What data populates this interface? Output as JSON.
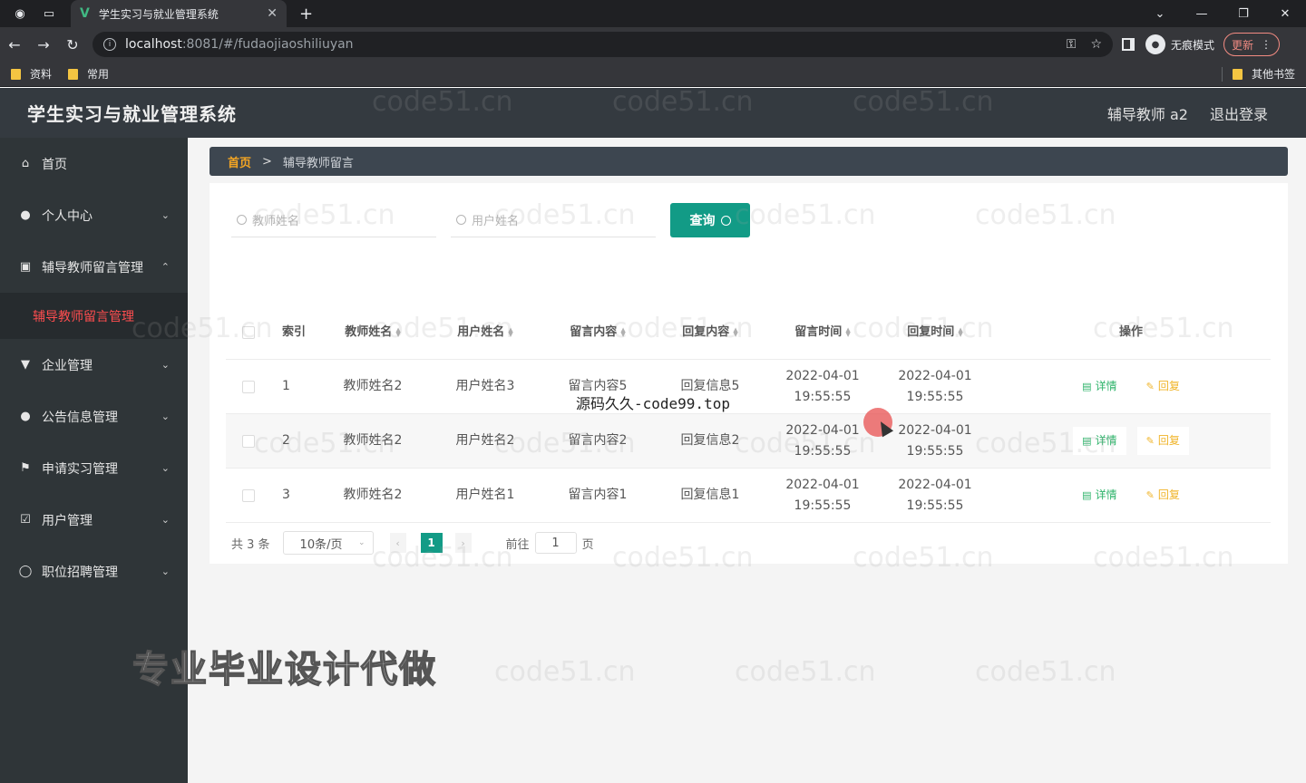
{
  "browser": {
    "tab_title": "学生实习与就业管理系统",
    "url_host": "localhost",
    "url_path": ":8081/#/fudaojiaoshiliuyan",
    "incognito_label": "无痕模式",
    "update_label": "更新",
    "bookmarks": [
      "资料",
      "常用"
    ],
    "other_bookmarks": "其他书签"
  },
  "header": {
    "title": "学生实习与就业管理系统",
    "user": "辅导教师 a2",
    "logout": "退出登录"
  },
  "sidebar": {
    "items": [
      {
        "label": "首页",
        "icon": "home-icon"
      },
      {
        "label": "个人中心",
        "icon": "user-icon"
      },
      {
        "label": "辅导教师留言管理",
        "icon": "message-icon"
      },
      {
        "label": "企业管理",
        "icon": "enterprise-icon"
      },
      {
        "label": "公告信息管理",
        "icon": "notice-icon"
      },
      {
        "label": "申请实习管理",
        "icon": "flag-icon"
      },
      {
        "label": "用户管理",
        "icon": "users-icon"
      },
      {
        "label": "职位招聘管理",
        "icon": "job-icon"
      }
    ],
    "active_submenu": "辅导教师留言管理"
  },
  "breadcrumb": {
    "home": "首页",
    "separator": ">",
    "current": "辅导教师留言"
  },
  "search": {
    "teacher_placeholder": "教师姓名",
    "user_placeholder": "用户姓名",
    "button_label": "查询"
  },
  "table": {
    "headers": [
      "索引",
      "教师姓名",
      "用户姓名",
      "留言内容",
      "回复内容",
      "留言时间",
      "回复时间",
      "操作"
    ],
    "rows": [
      {
        "index": "1",
        "teacher": "教师姓名2",
        "user": "用户姓名3",
        "message": "留言内容5",
        "reply": "回复信息5",
        "msg_time": "2022-04-01 19:55:55",
        "reply_time": "2022-04-01 19:55:55"
      },
      {
        "index": "2",
        "teacher": "教师姓名2",
        "user": "用户姓名2",
        "message": "留言内容2",
        "reply": "回复信息2",
        "msg_time": "2022-04-01 19:55:55",
        "reply_time": "2022-04-01 19:55:55"
      },
      {
        "index": "3",
        "teacher": "教师姓名2",
        "user": "用户姓名1",
        "message": "留言内容1",
        "reply": "回复信息1",
        "msg_time": "2022-04-01 19:55:55",
        "reply_time": "2022-04-01 19:55:55"
      }
    ],
    "detail_label": "详情",
    "reply_label": "回复"
  },
  "pager": {
    "total": "共 3 条",
    "page_size": "10条/页",
    "current_page": "1",
    "goto_label": "前往",
    "goto_value": "1",
    "page_unit": "页"
  },
  "overlays": {
    "watermark": "code51.cn",
    "source_text": "源码久久-code99.top",
    "promo_text": "专业毕业设计代做"
  },
  "colors": {
    "accent": "#129b86",
    "active_menu": "#ff4d4f",
    "sidebar_bg": "#2f3538",
    "header_bg": "#343a40"
  }
}
